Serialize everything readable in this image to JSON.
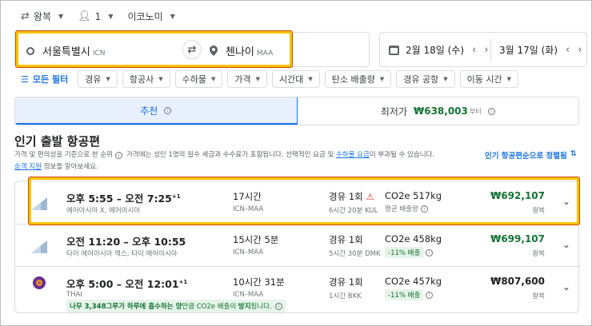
{
  "top": {
    "trip_type": "왕복",
    "passengers": "1",
    "cabin": "이코노미"
  },
  "search": {
    "origin": "서울특별시",
    "origin_code": "ICN",
    "destination": "첸나이",
    "destination_code": "MAA",
    "depart_date": "2월 18일 (수)",
    "return_date": "3월 17일 (화)"
  },
  "filters": {
    "all": "모든 필터",
    "chips": [
      "경유",
      "항공사",
      "수하물",
      "가격",
      "시간대",
      "탄소 배출량",
      "경유 공항",
      "이동 시간"
    ]
  },
  "tabs": {
    "recommended": "추천",
    "cheapest_label": "최저가",
    "cheapest_price": "₩638,003",
    "cheapest_suffix": "부터"
  },
  "section": {
    "title": "인기 출발 항공편",
    "desc1": "가격 및 편의성을 기준으로 한 순위",
    "desc2": "가격에는 성인 1명의 필수 세금과 수수료가 포함됩니다. 선택적인 요금 및",
    "desc_link": "수하물 요금",
    "desc3": "이 부과될 수 있습니다.",
    "desc_link2": "승객 지원",
    "desc4": "정보를 알아보세요.",
    "sort": "인기 항공편순으로 정렬됨"
  },
  "flights": [
    {
      "times": "오후 5:55 – 오전 7:25",
      "plus": "+1",
      "airline": "에어아시아 X, 에어아시아",
      "duration": "17시간",
      "route": "ICN–MAA",
      "stops": "경유 1회",
      "layover": "6시간 20분 KUL",
      "co2": "CO2e 517kg",
      "co2_sub": "평균 배출량",
      "price": "₩692,107",
      "price_type": "왕복"
    },
    {
      "times": "오전 11:20 – 오후 10:55",
      "plus": "",
      "airline": "타이 에어아시아 엑스, 타이 에어아시아",
      "duration": "15시간 5분",
      "route": "ICN–MAA",
      "stops": "경유 1회",
      "layover": "5시간 30분 DMK",
      "co2": "CO2e 458kg",
      "co2_sub": "-11% 배출",
      "price": "₩699,107",
      "price_type": "왕복"
    },
    {
      "times": "오후 5:00 – 오전 12:01",
      "plus": "+1",
      "airline": "THAI",
      "duration": "10시간 31분",
      "route": "ICN–MAA",
      "stops": "경유 1회",
      "layover": "1시간 BKK",
      "co2": "CO2e 457kg",
      "co2_sub": "-11% 배출",
      "price": "₩807,600",
      "price_type": "왕복",
      "eco_bold1": "나무 3,348그루가 하루에 흡수하는 양",
      "eco_mid": "만큼 CO2e 배출이",
      "eco_bold2": "방지",
      "eco_end": "됩니다."
    }
  ],
  "colors": {
    "accent": "#1a73e8",
    "price_green": "#137333",
    "highlight": "#f5c400"
  }
}
